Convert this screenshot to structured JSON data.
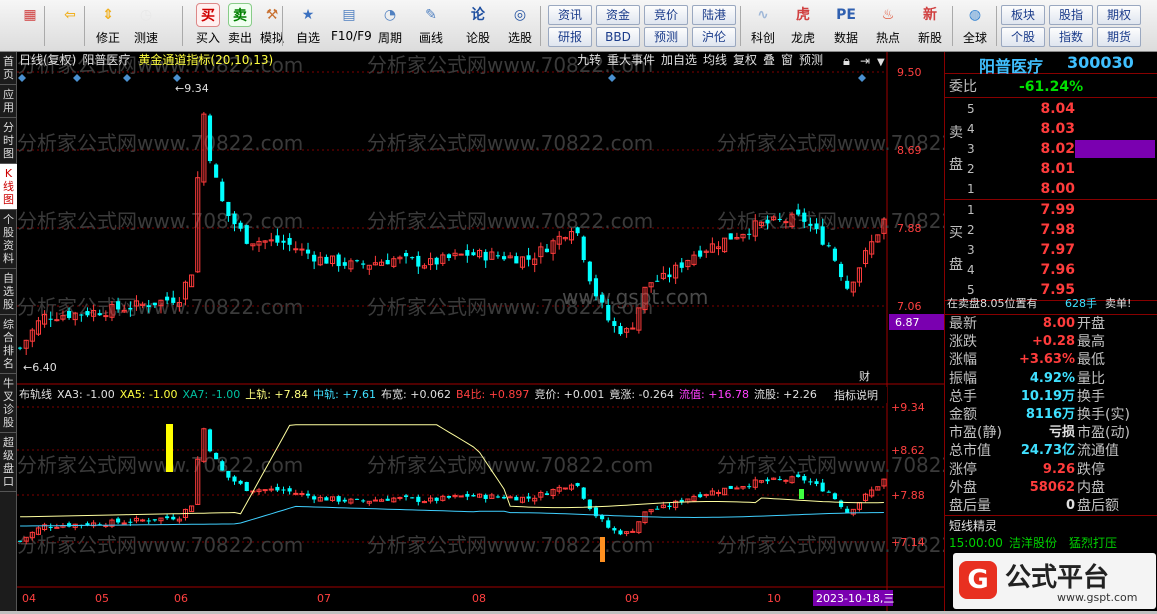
{
  "toolbar": {
    "items": [
      {
        "label": "",
        "icon": "grid-icon"
      },
      {
        "label": "",
        "icon": "back-arrow-icon"
      },
      {
        "label": "修正",
        "icon": "up-down-arrow-icon"
      },
      {
        "label": "测速",
        "icon": "clock-icon"
      },
      {
        "label": "买入",
        "icon": "buy-icon",
        "glyph": "买"
      },
      {
        "label": "卖出",
        "icon": "sell-icon",
        "glyph": "卖"
      },
      {
        "label": "模拟",
        "icon": "hammer-icon"
      },
      {
        "label": "自选",
        "icon": "folder-icon"
      },
      {
        "label": "F10/F9",
        "icon": "window-icon"
      },
      {
        "label": "周期",
        "icon": "period-icon"
      },
      {
        "label": "画线",
        "icon": "pencil-icon"
      },
      {
        "label": "论股",
        "icon": "discuss-icon"
      },
      {
        "label": "选股",
        "icon": "pick-icon"
      },
      {
        "label": "科创",
        "icon": "chart-icon"
      },
      {
        "label": "龙虎",
        "icon": "tiger-icon"
      },
      {
        "label": "数据",
        "icon": "pe-icon",
        "glyph": "PE"
      },
      {
        "label": "热点",
        "icon": "fire-icon"
      },
      {
        "label": "新股",
        "icon": "new-stock-icon"
      },
      {
        "label": "全球",
        "icon": "globe-icon"
      }
    ],
    "quick_top": [
      "资讯",
      "资金",
      "竞价",
      "陆港"
    ],
    "quick_bottom": [
      "研报",
      "BBD",
      "预测",
      "沪伦"
    ],
    "quick_right_top": [
      "板块",
      "股指",
      "期权"
    ],
    "quick_right_bottom": [
      "个股",
      "指数",
      "期货"
    ]
  },
  "leftnav": [
    "首页",
    "应用",
    "分时图",
    "K线图",
    "个股资料",
    "自选股",
    "综合排名",
    "牛叉诊股",
    "超级盘口"
  ],
  "main": {
    "period": "日线(复权)",
    "stock_name": "阳普医疗",
    "indicator": "黄金通道指标(20,10,13)",
    "toolbar": [
      "九转",
      "重大事件",
      "加自选",
      "均线",
      "复权",
      "叠",
      "窗",
      "预测"
    ],
    "price_labels": [
      "9.50",
      "8.69",
      "7.88",
      "7.06"
    ],
    "current_price_tag": "6.87",
    "high_mark": "9.34",
    "low_mark": "6.40",
    "fin_badge": "财",
    "watermark": "分析家公式网www.70822.com",
    "center_watermark": "www.gspt.com"
  },
  "sub": {
    "name": "布轨线",
    "values": [
      {
        "k": "XA3:",
        "v": "-1.00",
        "c": "#e0e0e0"
      },
      {
        "k": "XA5:",
        "v": "-1.00",
        "c": "#ffff40"
      },
      {
        "k": "XA7:",
        "v": "-1.00",
        "c": "#00c0a0"
      },
      {
        "k": "上轨:",
        "v": "+7.84",
        "c": "#ffff80"
      },
      {
        "k": "中轨:",
        "v": "+7.61",
        "c": "#40e0ff"
      },
      {
        "k": "布宽:",
        "v": "+0.062",
        "c": "#e0e0e0"
      },
      {
        "k": "B4比:",
        "v": "+0.897",
        "c": "#ff4040"
      },
      {
        "k": "竞价:",
        "v": "+0.001",
        "c": "#e0e0e0"
      },
      {
        "k": "竟涨:",
        "v": "-0.264",
        "c": "#e0e0e0"
      },
      {
        "k": "流值:",
        "v": "+16.78",
        "c": "#ff40ff"
      },
      {
        "k": "流股:",
        "v": "+2.26",
        "c": "#e0e0e0"
      }
    ],
    "help": "指标说明",
    "price_labels": [
      "9.34",
      "8.62",
      "7.88",
      "7.14"
    ]
  },
  "xaxis": {
    "labels": [
      "04",
      "05",
      "06",
      "07",
      "08",
      "09",
      "10"
    ],
    "date_tag": "2023-10-18,三"
  },
  "panel": {
    "name": "阳普医疗",
    "code": "300030",
    "weibi_label": "委比",
    "weibi": "-61.24%",
    "sell_label": [
      "卖",
      "盘"
    ],
    "buy_label": [
      "买",
      "盘"
    ],
    "sells": [
      {
        "n": "5",
        "p": "8.04"
      },
      {
        "n": "4",
        "p": "8.03"
      },
      {
        "n": "3",
        "p": "8.02"
      },
      {
        "n": "2",
        "p": "8.01"
      },
      {
        "n": "1",
        "p": "8.00"
      }
    ],
    "buys": [
      {
        "n": "1",
        "p": "7.99"
      },
      {
        "n": "2",
        "p": "7.98"
      },
      {
        "n": "3",
        "p": "7.97"
      },
      {
        "n": "4",
        "p": "7.96"
      },
      {
        "n": "5",
        "p": "7.95"
      }
    ],
    "sell_pos": "在卖盘8.05位置有",
    "sell_qty": "628手",
    "sell_tag": "卖单!",
    "quotes": [
      {
        "l1": "最新",
        "v1": "8.00",
        "c1": "red",
        "l2": "开盘"
      },
      {
        "l1": "涨跌",
        "v1": "+0.28",
        "c1": "red",
        "l2": "最高"
      },
      {
        "l1": "涨幅",
        "v1": "+3.63%",
        "c1": "red",
        "l2": "最低"
      },
      {
        "l1": "振幅",
        "v1": "4.92%",
        "c1": "cyan",
        "l2": "量比"
      },
      {
        "l1": "总手",
        "v1": "10.19万",
        "c1": "cyan",
        "l2": "换手"
      },
      {
        "l1": "金额",
        "v1": "8116万",
        "c1": "cyan",
        "l2": "换手(实)"
      },
      {
        "l1": "市盈(静)",
        "v1": "亏损",
        "c1": "white",
        "l2": "市盈(动)"
      },
      {
        "l1": "总市值",
        "v1": "24.73亿",
        "c1": "cyan",
        "l2": "流通值"
      },
      {
        "l1": "涨停",
        "v1": "9.26",
        "c1": "red",
        "l2": "跌停"
      },
      {
        "l1": "外盘",
        "v1": "58062",
        "c1": "red",
        "l2": "内盘"
      },
      {
        "l1": "盘后量",
        "v1": "0",
        "c1": "white",
        "l2": "盘后额"
      }
    ],
    "shortline_label": "短线精灵",
    "shortline": {
      "time": "15:00:00",
      "name": "洁洋股份",
      "event": "猛烈打压"
    }
  },
  "logo": {
    "text": "公式平台",
    "url": "www.gspt.com"
  },
  "colors": {
    "up": "#ff3c3c",
    "down": "#00ffff",
    "grid": "#800000",
    "sell_highlight": "#7a00b0"
  }
}
